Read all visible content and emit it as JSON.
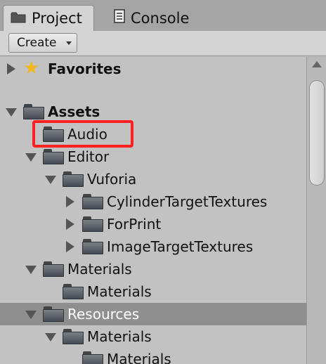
{
  "tabs": {
    "project": "Project",
    "console": "Console"
  },
  "toolbar": {
    "create_label": "Create"
  },
  "tree": {
    "favorites": "Favorites",
    "assets": "Assets",
    "audio": "Audio",
    "editor": "Editor",
    "vuforia": "Vuforia",
    "cylinder_target_textures": "CylinderTargetTextures",
    "for_print": "ForPrint",
    "image_target_textures": "ImageTargetTextures",
    "materials": "Materials",
    "materials_child": "Materials",
    "resources": "Resources",
    "resources_materials": "Materials",
    "resources_materials_child": "Materials"
  },
  "selected_item": "Resources",
  "highlighted_item": "Audio",
  "colors": {
    "highlight_box": "#ff2020",
    "selected_row": "#8f8f8f",
    "favorites_star": "#f2b71c",
    "folder": "#464c52"
  },
  "icons": {
    "project_tab": "folder-icon",
    "console_tab": "console-icon",
    "favorites": "star-icon"
  }
}
